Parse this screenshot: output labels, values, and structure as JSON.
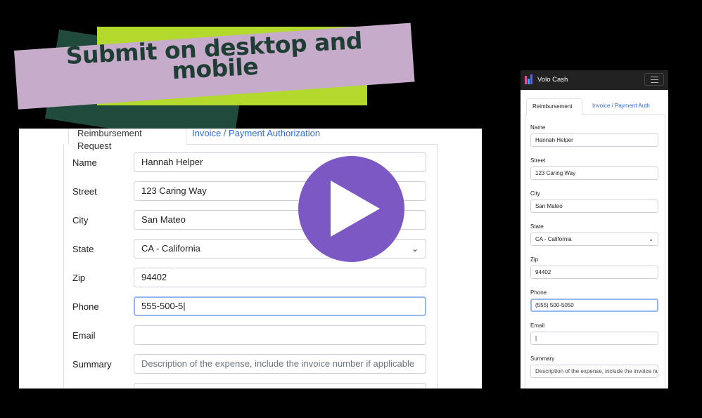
{
  "banner": {
    "title": "Submit on desktop and mobile"
  },
  "desktop": {
    "tabs": [
      "Reimbursement Request",
      "Invoice / Payment Authorization"
    ],
    "fields": [
      {
        "label": "Name",
        "value": "Hannah Helper"
      },
      {
        "label": "Street",
        "value": "123 Caring Way"
      },
      {
        "label": "City",
        "value": "San Mateo"
      },
      {
        "label": "State",
        "value": "CA - California"
      },
      {
        "label": "Zip",
        "value": "94402"
      },
      {
        "label": "Phone",
        "value": "555-500-5|"
      },
      {
        "label": "Email",
        "value": ""
      },
      {
        "label": "Summary",
        "placeholder": "Description of the expense, include the invoice number if applicable"
      }
    ]
  },
  "mobile": {
    "brand": "Volo Cash",
    "tabs": [
      "Reimbursement",
      "Invoice / Payment Auth"
    ],
    "fields": [
      {
        "label": "Name",
        "value": "Hannah Helper"
      },
      {
        "label": "Street",
        "value": "123 Caring Way"
      },
      {
        "label": "City",
        "value": "San Mateo"
      },
      {
        "label": "State",
        "value": "CA - California"
      },
      {
        "label": "Zip",
        "value": "94402"
      },
      {
        "label": "Phone",
        "value": "(555) 500-5050"
      },
      {
        "label": "Email",
        "value": "|"
      },
      {
        "label": "Summary",
        "placeholder": "Description of the expense, include the invoice number if applicable"
      }
    ]
  },
  "icons": {
    "play": "play-icon",
    "select": "chevron-down-icon",
    "menu": "hamburger-icon",
    "logo": "volo-logo-icon"
  },
  "colors": {
    "banner_green": "#b2d92b",
    "banner_lilac": "#c6acca",
    "banner_dark": "#1f4a3c",
    "play": "#7b58c3",
    "link": "#2d6bd1"
  }
}
